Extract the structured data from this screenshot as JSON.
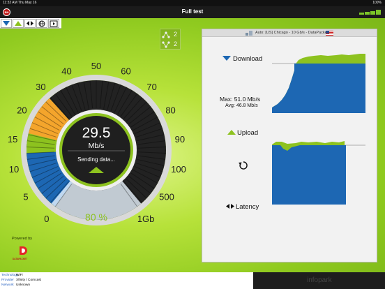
{
  "status_bar": {
    "time_date": "11:32 AM  Thu May 16",
    "battery": "100%"
  },
  "app": {
    "title": "Full test",
    "brand_logo_text": "BN"
  },
  "nav": {
    "icons": [
      "download-arrow-icon",
      "upload-arrow-icon",
      "latency-arrows-icon",
      "globe-icon",
      "video-icon"
    ]
  },
  "connections": {
    "download_count": "2",
    "upload_count": "2"
  },
  "server": {
    "label": "Auto: [US] Chicago - 10 Gb/s - DataPacket",
    "flag": "us-flag-icon"
  },
  "gauge": {
    "value": "29.5",
    "unit": "Mb/s",
    "status": "Sending data...",
    "progress": "80 %",
    "progress_fraction": 0.8,
    "needle_value": 29.5,
    "scale_labels": [
      "0",
      "5",
      "10",
      "15",
      "20",
      "30",
      "40",
      "50",
      "60",
      "70",
      "80",
      "90",
      "100",
      "500",
      "1Gb"
    ]
  },
  "download": {
    "title": "Download",
    "max": "Max: 51.0 Mb/s",
    "avg": "Avg: 46.8 Mb/s"
  },
  "upload": {
    "title": "Upload"
  },
  "latency": {
    "title": "Latency"
  },
  "powered_by": {
    "label": "Powered by",
    "logo_text": "DATAPACKET"
  },
  "meta": [
    {
      "key": "Technology",
      "value": "WiFi"
    },
    {
      "key": "Provider",
      "value": "Xfinity / Comcast"
    },
    {
      "key": "Network",
      "value": "Unknown"
    }
  ],
  "footer": {
    "watermark": "infopark"
  },
  "colors": {
    "green": "#8dc21f",
    "blue": "#1d67b3",
    "orange": "#f4a52c",
    "dark_gauge": "#333333"
  }
}
